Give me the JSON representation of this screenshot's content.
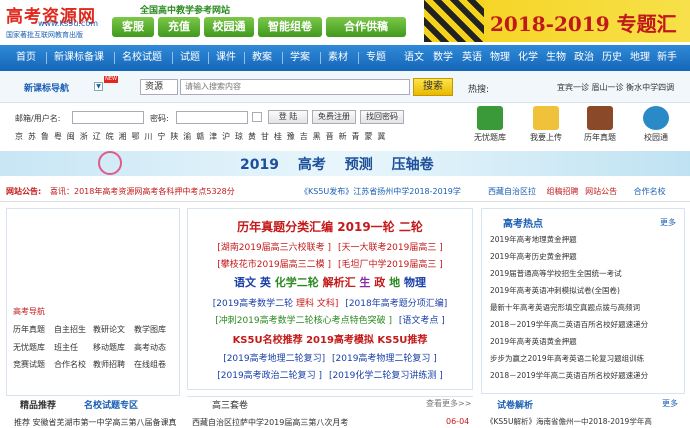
{
  "header": {
    "logo_text": "高考资源网",
    "logo_url": "www.ks5u.com",
    "logo_sub": "国家著批互联网教育出版",
    "slogan": "全国高中教学参考网站",
    "top_buttons": [
      "客服",
      "充值",
      "校园通",
      "智能组卷",
      "合作供稿"
    ],
    "banner_text": "2018-2019 专题汇总"
  },
  "nav": {
    "items": [
      "首页",
      "新课标备课",
      "名校试题",
      "试题",
      "课件",
      "教案",
      "学案",
      "素材",
      "专题"
    ],
    "subjects": [
      "语文",
      "数学",
      "英语",
      "物理",
      "化学",
      "生物",
      "政治",
      "历史",
      "地理",
      "新手"
    ]
  },
  "search": {
    "label": "新课标导航",
    "badge": "NEW",
    "select_value": "资源",
    "placeholder": "请输入搜索内容",
    "button": "搜索",
    "hot_label": "热搜:",
    "hot_links": "宜宾一诊  眉山一诊  衡水中学四调"
  },
  "login": {
    "user_label": "邮箱/用户名:",
    "pwd_label": "密码:",
    "login_btn": "登 陆",
    "register_btn": "免费注册",
    "retrieve_btn": "找回密码",
    "provinces": "京 苏 鲁 粤 闽 浙 辽 皖 湘 鄂 川 宁 陕 渝 赣 津 沪 琼   黄 甘 桂 豫 吉 黑 晋 新 青 蒙 冀"
  },
  "quick_icons": [
    "无忧题库",
    "我要上传",
    "历年真题",
    "校园通"
  ],
  "promo": {
    "text": "2019 高考 预测 压轴卷"
  },
  "notice": {
    "label": "网站公告:",
    "text": "喜讯：2018年高考资源网高考各科押中考点5328分",
    "mid": "《KS5U发布》江苏省扬州中学2018-2019学",
    "right_items": [
      "西藏自治区拉",
      "组稿招聘",
      "网站公告",
      "合作名校"
    ]
  },
  "left": {
    "title": "高考导航",
    "items": [
      [
        "历年真题",
        "自主招生",
        "教研论文",
        "教学图库"
      ],
      [
        "无忧题库",
        "班主任",
        "移动题库",
        "高考动态"
      ],
      [
        "竞赛试题",
        "合作名校",
        "教师招聘",
        "在线组卷"
      ]
    ]
  },
  "center": {
    "line1": "历年真题分类汇编  2019一轮  二轮",
    "line2a": "[湖南2019届高三六校联考 ]",
    "line2b": "[天一大联考2019届高三 ]",
    "line3a": "[攀枝花市2019届高三二模 ]",
    "line3b": "[毛坦厂中学2019届高三 ]",
    "subjects": [
      "语文",
      "英",
      "化学二轮",
      "解析汇",
      "生",
      "政",
      "地",
      "物理"
    ],
    "line5a": "[2019高考数学二轮",
    "line5b": "理科",
    "line5c": "文科]",
    "line5d": "[2018年高考题分项汇编]",
    "line6a": "[冲刺2019高考数学二轮核心考点特色突破 ]",
    "line6b": "[语文考点 ]",
    "line7": "KS5U名校推荐  2019高考模拟  KS5U推荐",
    "line8a": "[2019高考地理二轮复习]",
    "line8b": "[2019高考物理二轮复习 ]",
    "line9a": "[2019高考政治二轮复习 ]",
    "line9b": "[2019化学二轮复习讲练测 ]"
  },
  "right": {
    "title": "高考热点",
    "more": "更多",
    "items": [
      "2019年高考地理黄金押题",
      "2019年高考历史黄金押题",
      "2019届普通高等学校招生全国统一考试",
      "2019年高考英语冲刺模拟试卷(全国卷)",
      "最新十年高考英语完形填空真题点拨与高频词",
      "2018－2019学年高二英语百所名校好题速递分",
      "2019年高考英语黄金押题",
      "步步为赢之2019年高考英语二轮复习题组训练",
      "2018－2019学年高二英语百所名校好题速递分"
    ]
  },
  "bottom": {
    "tab1": "精品推荐",
    "tab2": "名校试题专区",
    "left_item": "推荐  安徽省芜湖市第一中学高三第八届备课真",
    "center_title": "高三套卷",
    "center_more": "查看更多>>",
    "center_item": "西藏自治区拉萨中学2019届高三第八次月考",
    "center_date": "06-04",
    "right_title": "试卷解析",
    "right_more": "更多",
    "right_item": "《KS5U解析》海南省儋州一中2018-2019学年高"
  },
  "colors": {
    "brand_red": "#e0281c",
    "nav_blue": "#1a6fc4",
    "button_green": "#4ea924",
    "link_blue": "#1a5fb4"
  }
}
